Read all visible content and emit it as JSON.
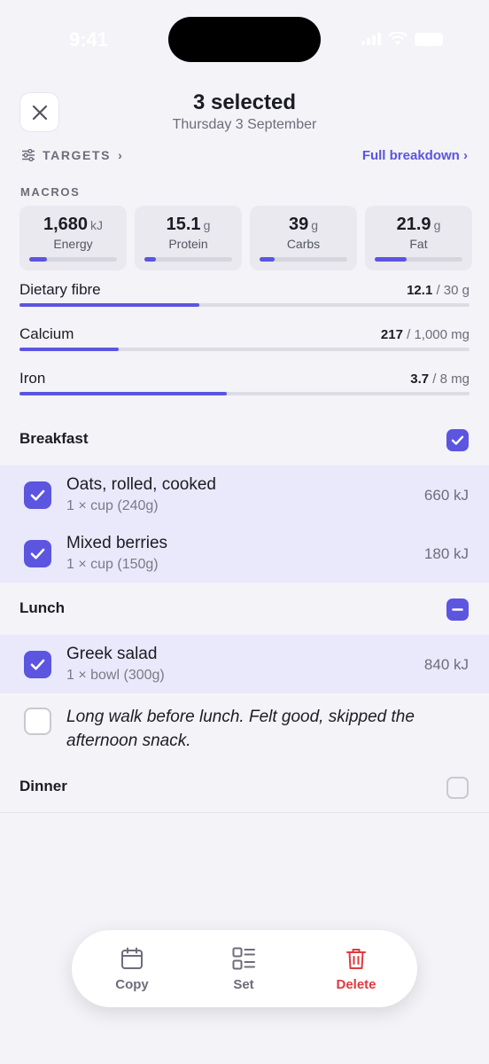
{
  "status": {
    "time": "9:41"
  },
  "header": {
    "title": "3 selected",
    "subtitle": "Thursday 3 September",
    "close_icon": "close-icon"
  },
  "targets": {
    "label": "TARGETS",
    "chevron": "›",
    "full_breakdown": "Full breakdown ›"
  },
  "macros": {
    "label": "MACROS",
    "items": [
      {
        "value": "1,680",
        "unit": "kJ",
        "name": "Energy",
        "progress": 0.2
      },
      {
        "value": "15.1",
        "unit": "g",
        "name": "Protein",
        "progress": 0.13
      },
      {
        "value": "39",
        "unit": "g",
        "name": "Carbs",
        "progress": 0.17
      },
      {
        "value": "21.9",
        "unit": "g",
        "name": "Fat",
        "progress": 0.36
      }
    ]
  },
  "nutrients": [
    {
      "name": "Dietary fibre",
      "value": "12.1",
      "target": " / 30 g",
      "progress": 0.4
    },
    {
      "name": "Calcium",
      "value": "217",
      "target": " / 1,000 mg",
      "progress": 0.22
    },
    {
      "name": "Iron",
      "value": "3.7",
      "target": " / 8 mg",
      "progress": 0.46
    }
  ],
  "meals": {
    "breakfast": {
      "title": "Breakfast",
      "state": "checked",
      "items": [
        {
          "name": "Oats, rolled, cooked",
          "serving": "1 × cup (240g)",
          "energy": "660 kJ",
          "selected": true
        },
        {
          "name": "Mixed berries",
          "serving": "1 × cup (150g)",
          "energy": "180 kJ",
          "selected": true
        }
      ]
    },
    "lunch": {
      "title": "Lunch",
      "state": "partial",
      "items": [
        {
          "name": "Greek salad",
          "serving": "1 × bowl (300g)",
          "energy": "840 kJ",
          "selected": true
        }
      ],
      "note": "Long walk before lunch. Felt good, skipped the afternoon snack."
    },
    "dinner": {
      "title": "Dinner",
      "state": "unchecked"
    }
  },
  "toolbar": {
    "copy": "Copy",
    "set": "Set",
    "delete": "Delete"
  },
  "colors": {
    "accent": "#5b55e0",
    "danger": "#e0393e",
    "selected_bg": "#e9e9fb"
  }
}
